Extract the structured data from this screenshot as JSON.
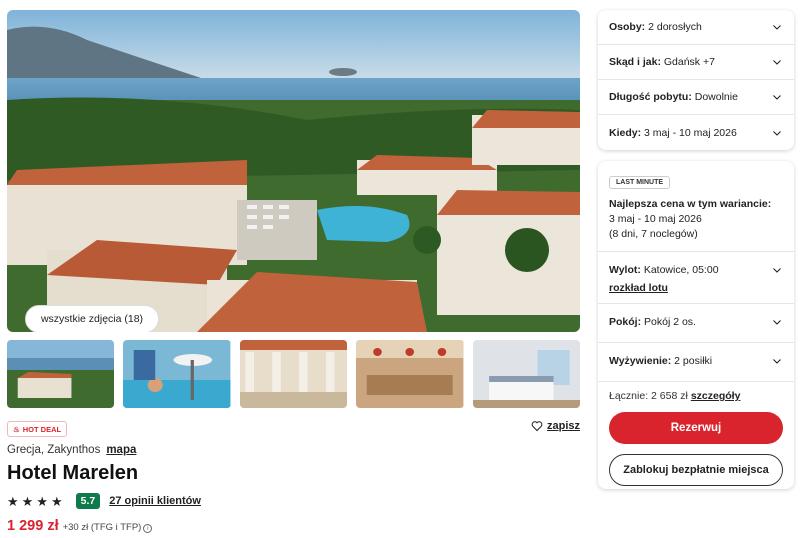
{
  "gallery": {
    "all_photos": "wszystkie zdjęcia (18)"
  },
  "badges": {
    "hot_deal": "HOT DEAL"
  },
  "actions": {
    "save": "zapisz"
  },
  "hotel": {
    "location": "Grecja, Zakynthos",
    "map_link": "mapa",
    "name": "Hotel Marelen",
    "stars": 4,
    "score": "5.7",
    "reviews": "27 opinii klientów",
    "price": "1 299 zł",
    "price_extra": "+30 zł (TFG i TFP)"
  },
  "filters": [
    {
      "label": "Osoby:",
      "value": "2 dorosłych"
    },
    {
      "label": "Skąd i jak:",
      "value": "Gdańsk +7"
    },
    {
      "label": "Długość pobytu:",
      "value": "Dowolnie"
    },
    {
      "label": "Kiedy:",
      "value": "3 maj - 10 maj 2026"
    }
  ],
  "offer": {
    "badge": "LAST MINUTE",
    "best_price": "Najlepsza cena w tym wariancie:",
    "dates": "3 maj - 10 maj 2026",
    "duration": "(8 dni, 7 noclegów)",
    "flight_label": "Wylot:",
    "flight_value": "Katowice, 05:00",
    "schedule_link": "rozkład lotu",
    "room_label": "Pokój:",
    "room_value": "Pokój 2 os.",
    "meals_label": "Wyżywienie:",
    "meals_value": "2 posiłki",
    "total_label": "Łącznie: 2 658 zł",
    "details_link": "szczegóły",
    "reserve": "Rezerwuj",
    "hold": "Zablokuj bezpłatnie miejsca"
  },
  "colors": {
    "accent": "#d9232d",
    "score": "#0e7a4b"
  }
}
